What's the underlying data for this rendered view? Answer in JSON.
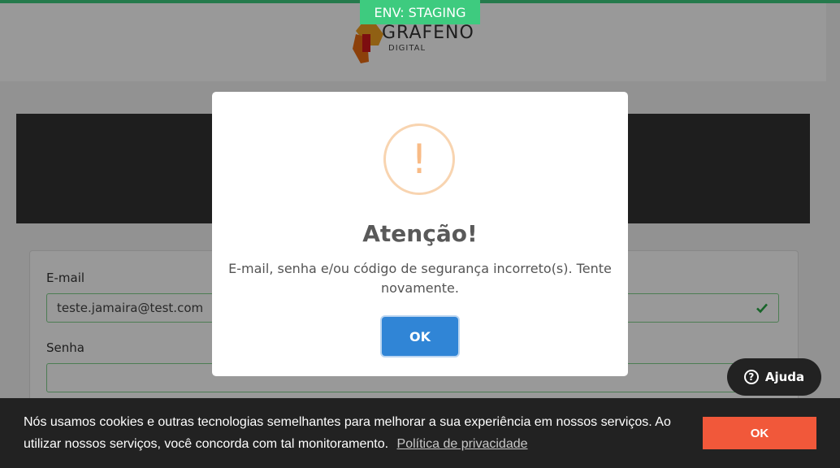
{
  "env_badge": "ENV: STAGING",
  "logo": {
    "name": "GRAFENO",
    "sub": "DIGITAL"
  },
  "login": {
    "email_label": "E-mail",
    "email_value": "teste.jamaira@test.com",
    "password_label": "Senha",
    "password_value": ""
  },
  "modal": {
    "icon_glyph": "!",
    "title": "Atenção!",
    "message": "E-mail, senha e/ou código de segurança incorreto(s). Tente novamente.",
    "ok_label": "OK"
  },
  "help": {
    "label": "Ajuda",
    "icon_glyph": "?"
  },
  "cookie": {
    "text": "Nós usamos cookies e outras tecnologias semelhantes para melhorar a sua experiência em nossos serviços. Ao utilizar nossos serviços, você concorda com tal monitoramento.",
    "link_label": "Política de privacidade",
    "ok_label": "OK"
  },
  "colors": {
    "env_green": "#3ecb7f",
    "modal_button": "#3085d6",
    "warning": "#f8bb86",
    "cookie_button": "#f1583a"
  }
}
